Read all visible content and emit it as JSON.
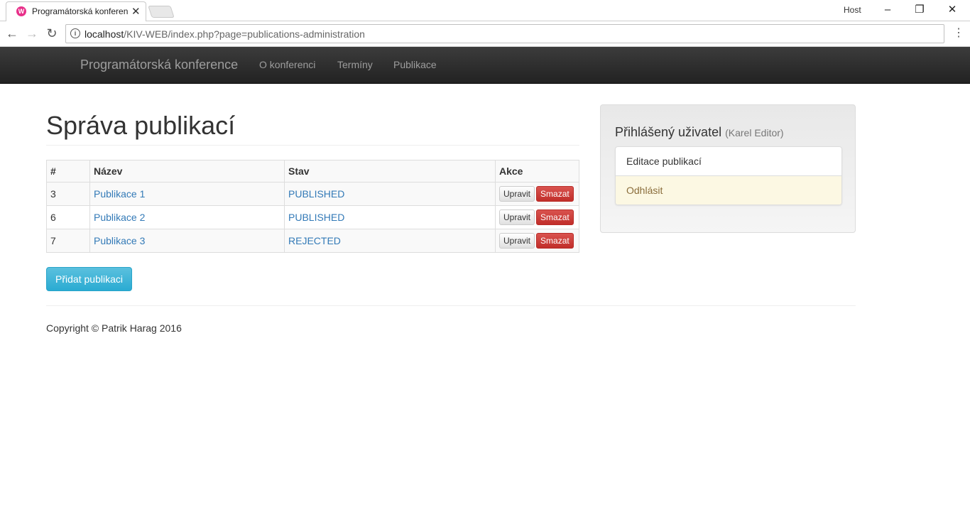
{
  "browser": {
    "tab_title": "Programátorská konferen",
    "tab_favicon": "W",
    "profile": "Host",
    "url_host": "localhost",
    "url_path": "/KIV-WEB/index.php?page=publications-administration"
  },
  "navbar": {
    "brand": "Programátorská konference",
    "links": [
      "O konferenci",
      "Termíny",
      "Publikace"
    ]
  },
  "main": {
    "title": "Správa publikací",
    "table": {
      "headers": [
        "#",
        "Název",
        "Stav",
        "Akce"
      ],
      "rows": [
        {
          "id": "3",
          "name": "Publikace 1",
          "status": "PUBLISHED"
        },
        {
          "id": "6",
          "name": "Publikace 2",
          "status": "PUBLISHED"
        },
        {
          "id": "7",
          "name": "Publikace 3",
          "status": "REJECTED"
        }
      ],
      "edit_label": "Upravit",
      "delete_label": "Smazat"
    },
    "add_button": "Přidat publikaci"
  },
  "sidebar": {
    "title": "Přihlášený uživatel",
    "user": "(Karel Editor)",
    "items": [
      "Editace publikací",
      "Odhlásit"
    ]
  },
  "footer": {
    "copyright": "Copyright © Patrik Harag 2016"
  },
  "colors": {
    "link": "#337ab7",
    "danger": "#d9534f",
    "info": "#5bc0de",
    "navbar": "#222222"
  }
}
